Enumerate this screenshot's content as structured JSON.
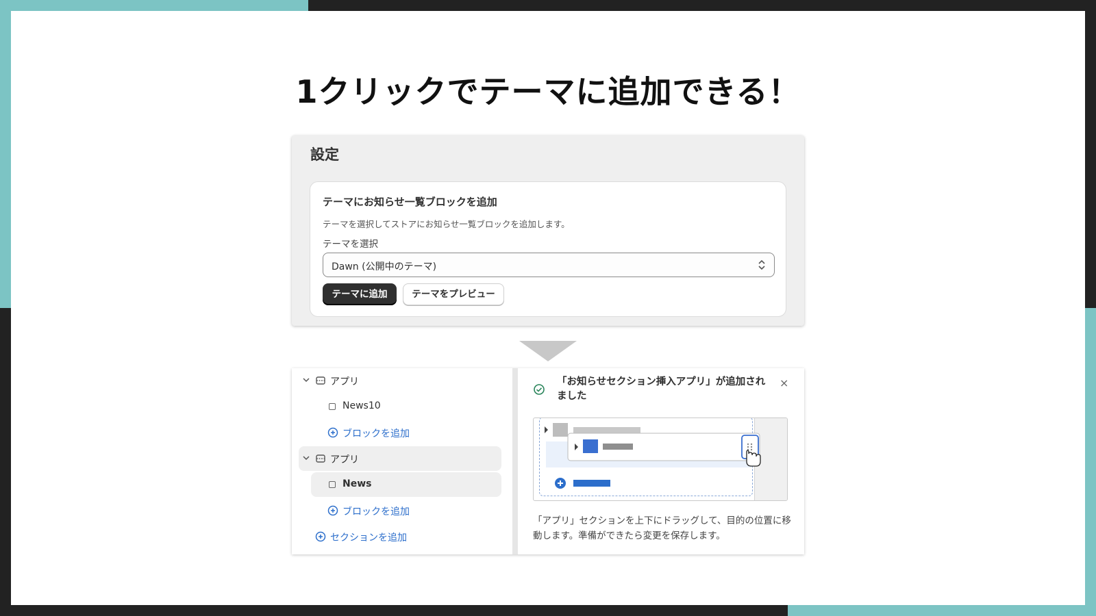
{
  "slide": {
    "title": "1クリックでテーマに追加できる！",
    "accent_color": "#7cc4c4",
    "frame_color": "#222222"
  },
  "settings": {
    "heading": "設定",
    "card": {
      "title": "テーマにお知らせ一覧ブロックを追加",
      "description": "テーマを選択してストアにお知らせ一覧ブロックを追加します。",
      "select_label": "テーマを選択",
      "select_value": "Dawn (公開中のテーマ)",
      "select_icon": "updown-chevron-icon",
      "primary_button": "テーマに追加",
      "secondary_button": "テーマをプレビュー"
    }
  },
  "editor": {
    "tree": {
      "section1_label": "アプリ",
      "section1_block": "News10",
      "section1_add_block": "ブロックを追加",
      "section2_label": "アプリ",
      "section2_block": "News",
      "section2_add_block": "ブロックを追加",
      "add_section": "セクションを追加"
    },
    "toast": {
      "message": "「お知らせセクション挿入アプリ」が追加されました",
      "close_label": "×",
      "status_icon": "check-circle-icon"
    },
    "illustration": {
      "icon_names": [
        "caret-right-icon",
        "drag-handle-icon",
        "hand-cursor-icon",
        "plus-circle-icon"
      ],
      "highlight_color": "#3a6fd0"
    },
    "caption": "「アプリ」セクションを上下にドラッグして、目的の位置に移動します。準備ができたら変更を保存します。"
  }
}
